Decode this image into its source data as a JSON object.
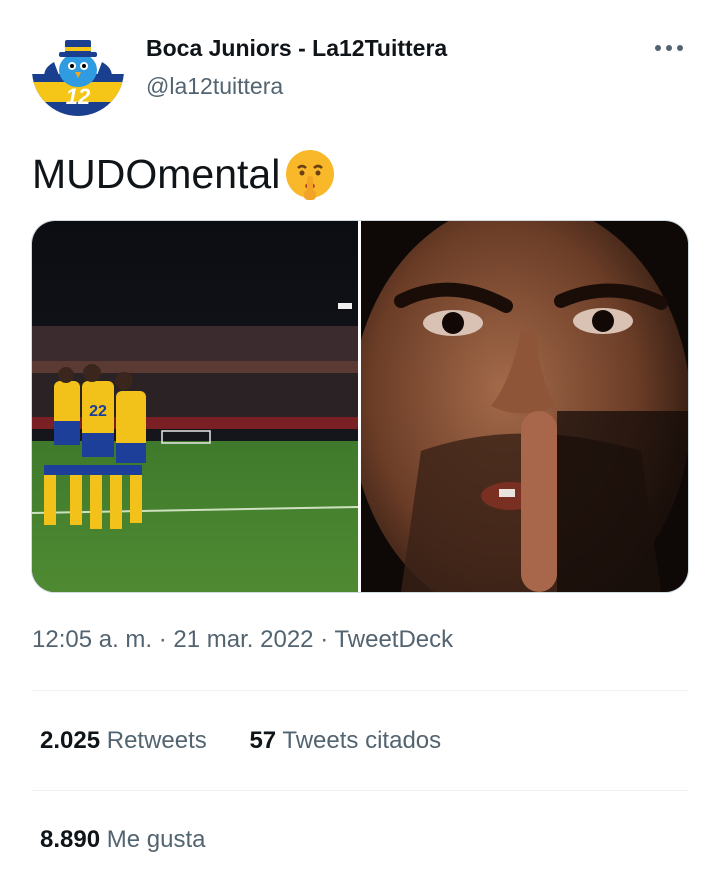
{
  "author": {
    "display_name": "Boca Juniors - La12Tuittera",
    "handle": "@la12tuittera",
    "avatar_icon": "boca-bird-avatar-icon"
  },
  "tweet": {
    "text": "MUDOmental",
    "emoji": "shushing-face-emoji"
  },
  "media": {
    "left_image": "football-players-celebrating-image",
    "right_image": "man-shushing-gesture-image"
  },
  "meta": {
    "time": "12:05 a. m.",
    "separator": "·",
    "date": "21 mar. 2022",
    "client": "TweetDeck"
  },
  "stats": {
    "retweets_count": "2.025",
    "retweets_label": "Retweets",
    "quotes_count": "57",
    "quotes_label": "Tweets citados",
    "likes_count": "8.890",
    "likes_label": "Me gusta"
  },
  "colors": {
    "primary_text": "#0f1419",
    "secondary_text": "#536471",
    "divider": "#eff3f4",
    "boca_blue": "#1b3f8f",
    "boca_yellow": "#f5c518"
  }
}
